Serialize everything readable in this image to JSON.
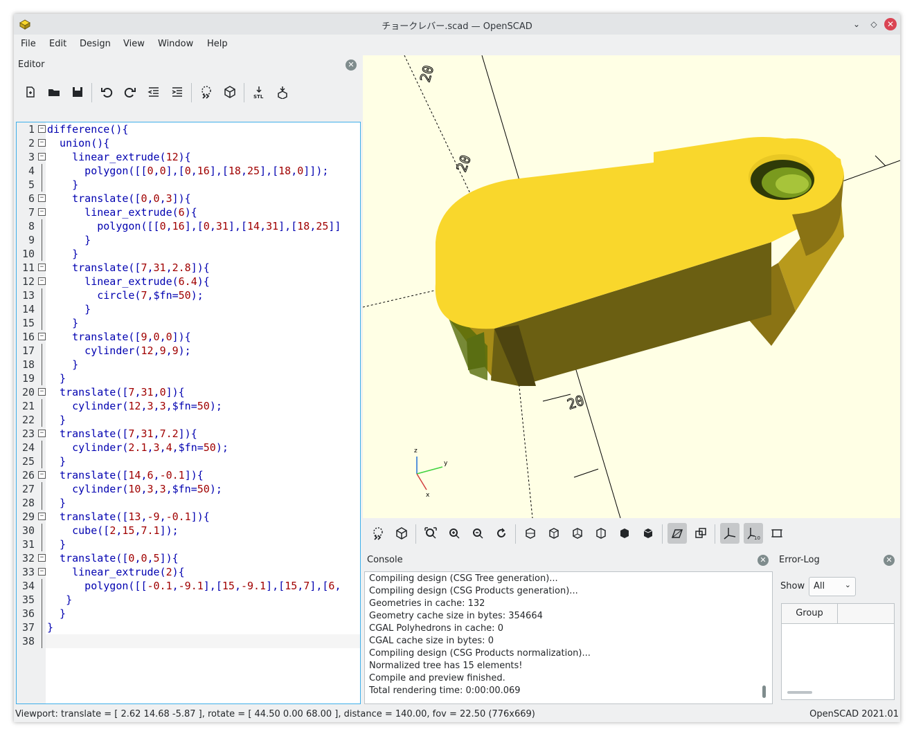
{
  "window": {
    "title": "チョークレバー.scad — OpenSCAD"
  },
  "menu": [
    "File",
    "Edit",
    "Design",
    "View",
    "Window",
    "Help"
  ],
  "editor": {
    "title": "Editor",
    "toolbar": [
      "new-file-icon",
      "open-file-icon",
      "save-icon",
      "undo-icon",
      "redo-icon",
      "unindent-icon",
      "indent-icon",
      "preview-icon",
      "render-icon",
      "export-stl-icon",
      "send-to-print-icon"
    ],
    "code_lines": [
      "difference(){",
      "  union(){",
      "    linear_extrude(12){",
      "      polygon([[0,0],[0,16],[18,25],[18,0]]);",
      "    }",
      "    translate([0,0,3]){",
      "      linear_extrude(6){",
      "        polygon([[0,16],[0,31],[14,31],[18,25]]",
      "      }",
      "    }",
      "    translate([7,31,2.8]){",
      "      linear_extrude(6.4){",
      "        circle(7,$fn=50);",
      "      }",
      "    }",
      "    translate([9,0,0]){",
      "      cylinder(12,9,9);",
      "    }",
      "  }",
      "  translate([7,31,0]){",
      "    cylinder(12,3,3,$fn=50);",
      "  }",
      "  translate([7,31,7.2]){",
      "    cylinder(2.1,3,4,$fn=50);",
      "  }",
      "  translate([14,6,-0.1]){",
      "    cylinder(10,3,3,$fn=50);",
      "  }",
      "  translate([13,-9,-0.1]){",
      "    cube([2,15,7.1]);",
      "  }",
      "  translate([0,0,5]){",
      "    linear_extrude(2){",
      "      polygon([[-0.1,-9.1],[15,-9.1],[15,7],[6,",
      "   }",
      "  }",
      "}",
      ""
    ],
    "fold_lines": [
      1,
      2,
      3,
      6,
      7,
      11,
      12,
      16,
      20,
      23,
      26,
      29,
      32,
      33
    ]
  },
  "viewport": {
    "axis_labels": {
      "z": "z",
      "y": "y",
      "x": "x"
    },
    "scale_label": "20",
    "model_color": "#f9d72c",
    "background": "#ffffe5"
  },
  "view_toolbar": [
    "preview-icon",
    "render-icon",
    "view-all-icon",
    "zoom-in-icon",
    "zoom-out-icon",
    "reset-view-icon",
    "view-right-icon",
    "view-top-icon",
    "view-bottom-icon",
    "view-left-icon",
    "view-front-icon",
    "view-back-icon",
    "perspective-icon",
    "orthogonal-icon",
    "show-axes-icon",
    "show-scale-markers-icon",
    "show-edges-icon"
  ],
  "console": {
    "title": "Console",
    "lines": [
      "Compiling design (CSG Tree generation)...",
      "Compiling design (CSG Products generation)...",
      "Geometries in cache: 132",
      "Geometry cache size in bytes: 354664",
      "CGAL Polyhedrons in cache: 0",
      "CGAL cache size in bytes: 0",
      "Compiling design (CSG Products normalization)...",
      "Normalized tree has 15 elements!",
      "Compile and preview finished.",
      "Total rendering time: 0:00:00.069"
    ]
  },
  "errorlog": {
    "title": "Error-Log",
    "show_label": "Show",
    "show_value": "All",
    "column_group": "Group"
  },
  "status": {
    "left": "Viewport: translate = [ 2.62 14.68 -5.87 ], rotate = [ 44.50 0.00 68.00 ], distance = 140.00, fov = 22.50 (776x669)",
    "right": "OpenSCAD 2021.01"
  }
}
